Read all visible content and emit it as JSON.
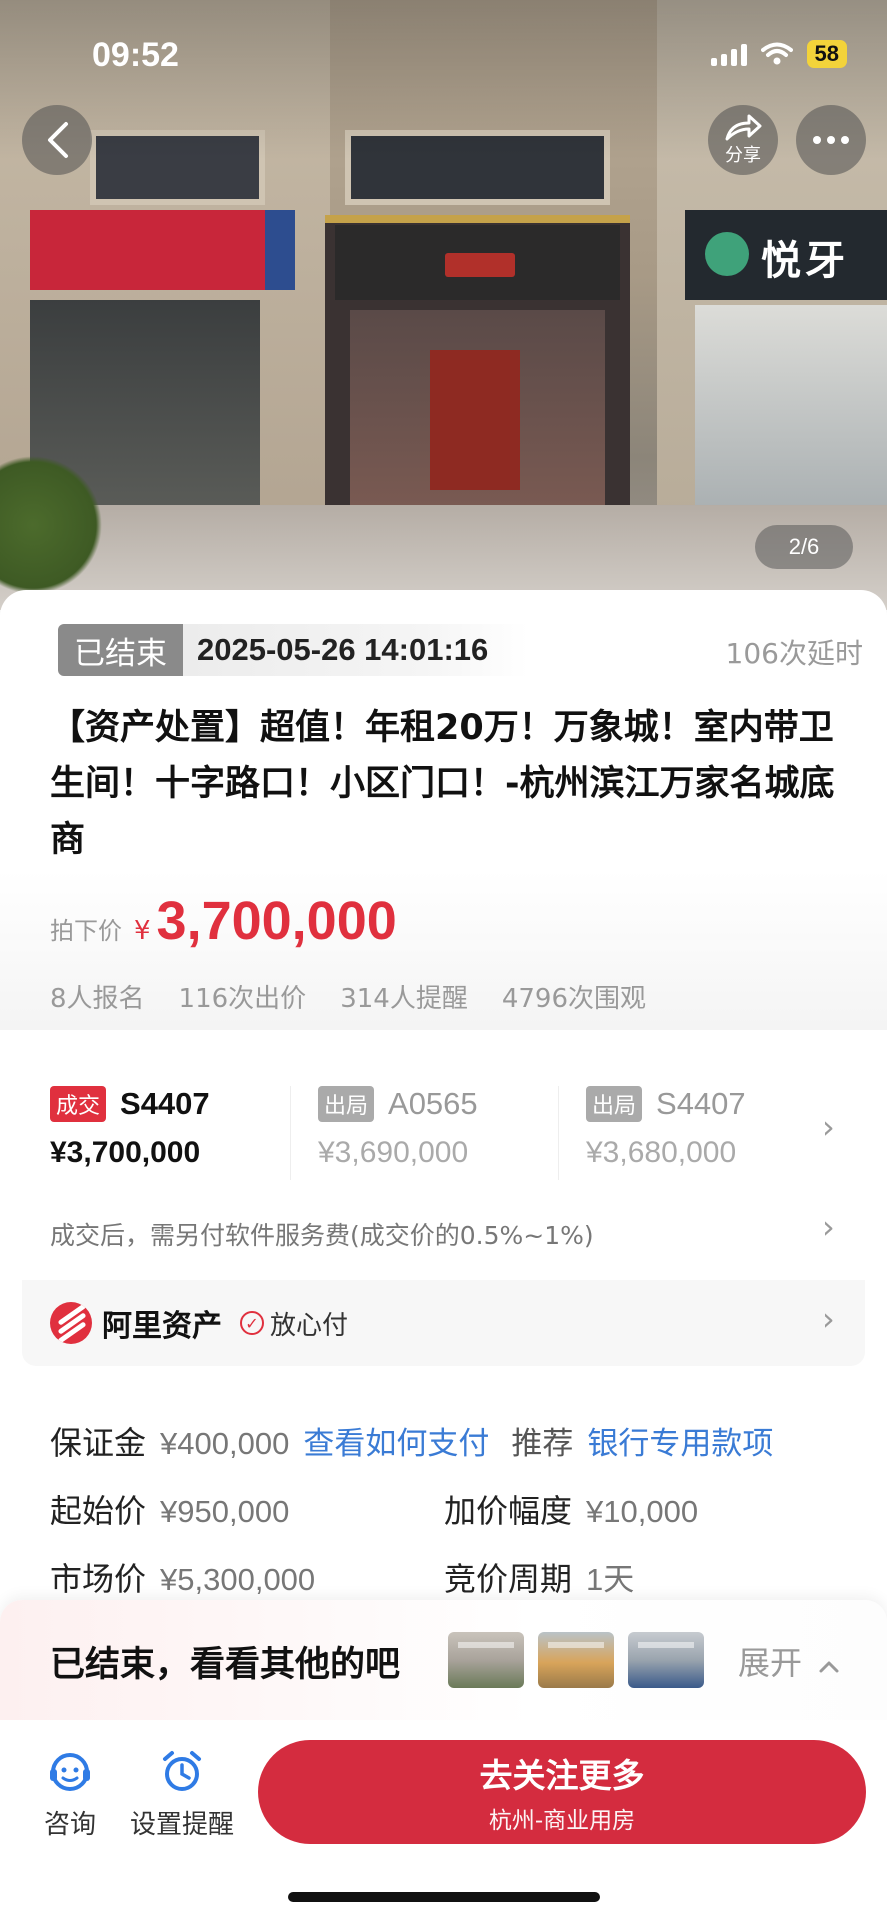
{
  "status_bar": {
    "time": "09:52",
    "battery": "58"
  },
  "gallery": {
    "counter": "2/6",
    "share_label": "分享",
    "store_sign": "悦牙"
  },
  "auction": {
    "status": "已结束",
    "end_time": "2025-05-26 14:01:16",
    "delay_count": "106次延时",
    "title": "【资产处置】超值！年租20万！万象城！室内带卫生间！十字路口！小区门口！-杭州滨江万家名城底商",
    "price_label": "拍下价",
    "price_currency": "¥",
    "price_value": "3,700,000",
    "stats": [
      "8人报名",
      "116次出价",
      "314人提醒",
      "4796次围观"
    ]
  },
  "bids": [
    {
      "tag": "成交",
      "code": "S4407",
      "price": "¥3,700,000",
      "state": "win"
    },
    {
      "tag": "出局",
      "code": "A0565",
      "price": "¥3,690,000",
      "state": "out"
    },
    {
      "tag": "出局",
      "code": "S4407",
      "price": "¥3,680,000",
      "state": "out"
    }
  ],
  "fee_note": "成交后，需另付软件服务费(成交价的0.5%~1%)",
  "ali": {
    "brand": "阿里资产",
    "safe_pay": "放心付"
  },
  "info": {
    "deposit_label": "保证金",
    "deposit_value": "¥400,000",
    "deposit_link": "查看如何支付",
    "recommend_label": "推荐",
    "recommend_link": "银行专用款项",
    "start_label": "起始价",
    "start_value": "¥950,000",
    "increment_label": "加价幅度",
    "increment_value": "¥10,000",
    "market_label": "市场价",
    "market_value": "¥5,300,000",
    "cycle_label": "竞价周期",
    "cycle_value": "1天"
  },
  "ended_banner": {
    "text": "已结束，看看其他的吧",
    "expand_label": "展开"
  },
  "bottom": {
    "consult_label": "咨询",
    "remind_label": "设置提醒",
    "follow_main": "去关注更多",
    "follow_sub": "杭州-商业用房"
  },
  "colors": {
    "accent": "#e0303e",
    "button": "#d42c3f",
    "link": "#3a7bd5"
  }
}
